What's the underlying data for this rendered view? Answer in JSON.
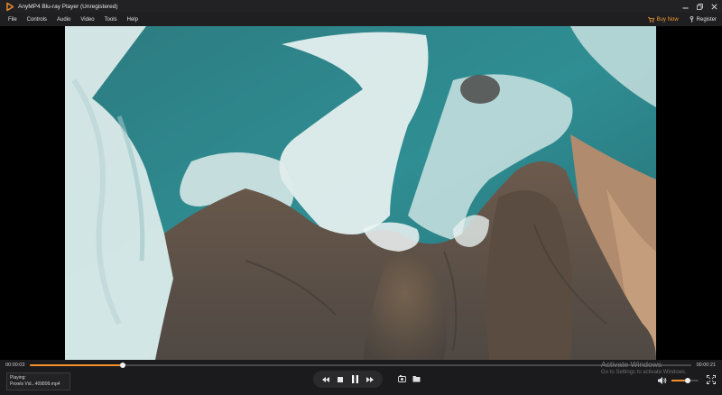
{
  "app": {
    "title": "AnyMP4 Blu-ray Player (Unregistered)"
  },
  "menu": [
    "File",
    "Controls",
    "Audio",
    "Video",
    "Tools",
    "Help"
  ],
  "header_actions": {
    "buy_now": "Buy Now",
    "register": "Register"
  },
  "playback": {
    "current_time": "00:00:03",
    "total_time": "00:00:21",
    "progress": 0.14,
    "playing_label": "Playing:",
    "file_name": "Pexels Vid...409899.mp4"
  },
  "volume": {
    "level": 0.6
  },
  "watermark": {
    "title": "Activate Windows",
    "subtitle": "Go to Settings to activate Windows."
  },
  "colors": {
    "accent": "#f3902a",
    "background": "#1b1b1d"
  },
  "icons": {
    "logo": "play-triangle-icon",
    "transport": [
      "rewind-icon",
      "stop-icon",
      "pause-icon",
      "fast-forward-icon"
    ],
    "extras": [
      "snapshot-icon",
      "folder-icon"
    ]
  }
}
